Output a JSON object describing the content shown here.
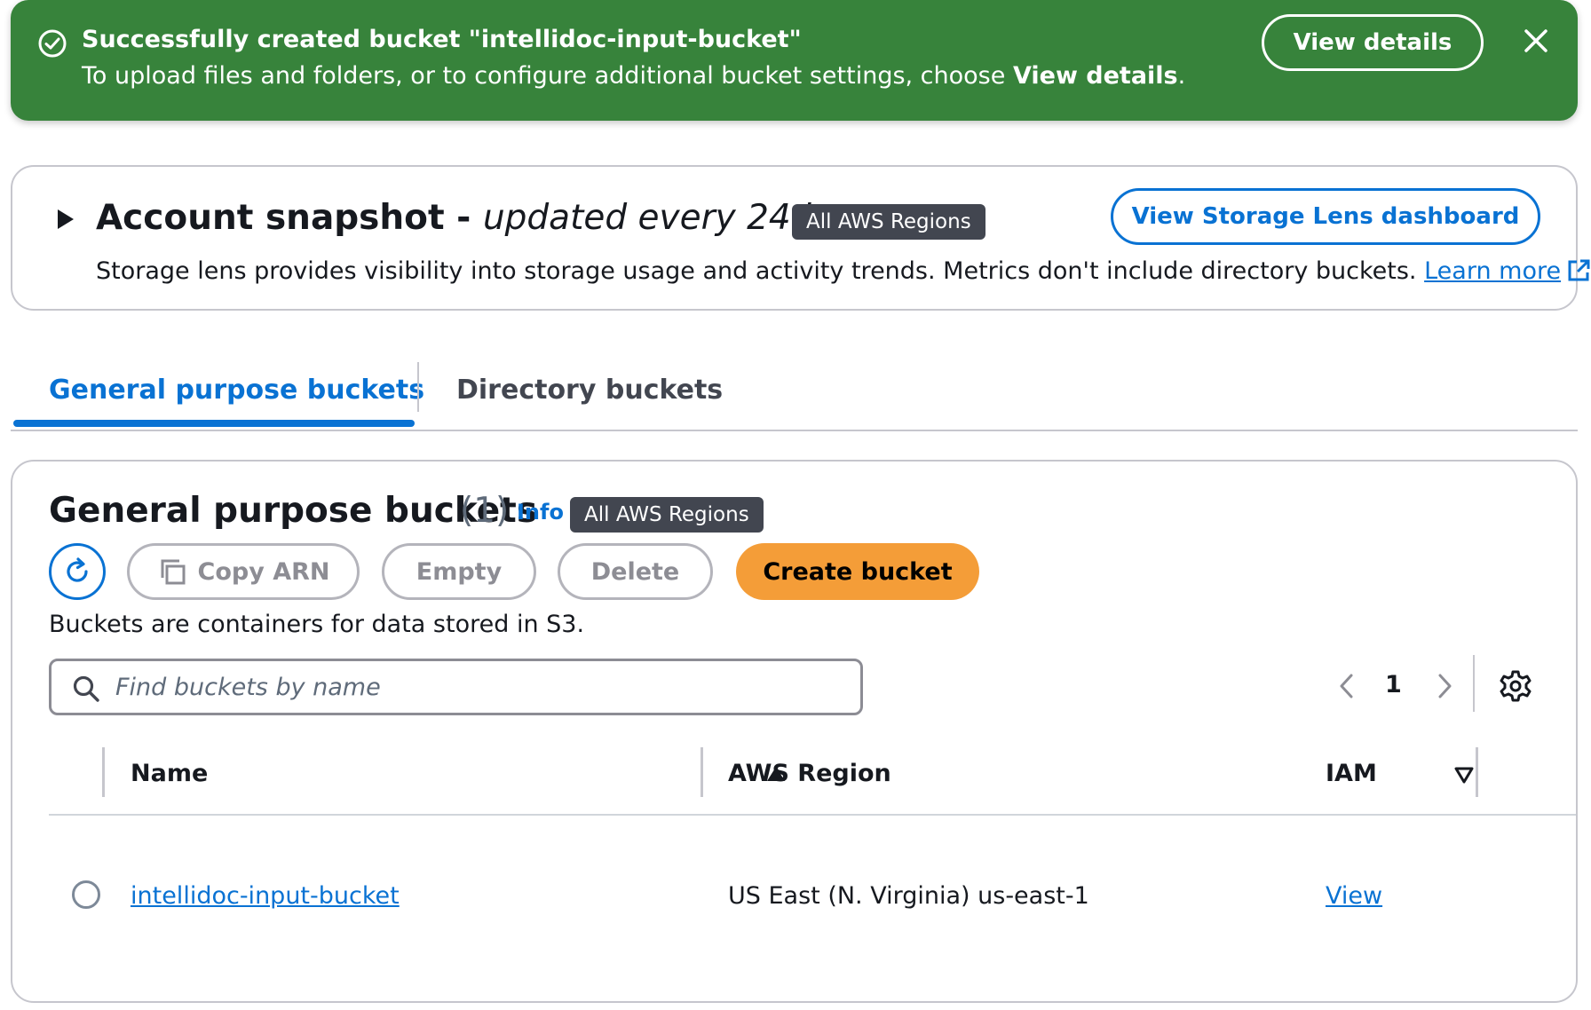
{
  "flash": {
    "title": "Successfully created bucket \"intellidoc-input-bucket\"",
    "message": "To upload files and folders, or to configure additional bucket settings, choose ",
    "message_bold": "View details",
    "message_end": ".",
    "button_label": "View details",
    "color": "#37833b"
  },
  "snapshot": {
    "title": "Account snapshot",
    "separator": " - ",
    "subtitle": "updated every 24 hours",
    "badge": "All AWS Regions",
    "description": "Storage lens provides visibility into storage usage and activity trends. Metrics don't include directory buckets. ",
    "learn_more": "Learn more",
    "dashboard_button": "View Storage Lens dashboard"
  },
  "tabs": [
    {
      "label": "General purpose buckets",
      "active": true
    },
    {
      "label": "Directory buckets",
      "active": false
    }
  ],
  "panel": {
    "title": "General purpose buckets",
    "count": "(1)",
    "info": "Info",
    "badge": "All AWS Regions",
    "actions": {
      "copy_arn": "Copy ARN",
      "empty": "Empty",
      "delete": "Delete",
      "create": "Create bucket"
    },
    "description": "Buckets are containers for data stored in S3.",
    "search_placeholder": "Find buckets by name",
    "page": "1"
  },
  "table": {
    "columns": [
      "Name",
      "AWS Region",
      "IAM"
    ],
    "rows": [
      {
        "name": "intellidoc-input-bucket",
        "region": "US East (N. Virginia) us-east-1",
        "iam": "View"
      }
    ]
  },
  "colors": {
    "accent": "#0972d3",
    "primary_button": "#f49d38",
    "success": "#37833b"
  }
}
